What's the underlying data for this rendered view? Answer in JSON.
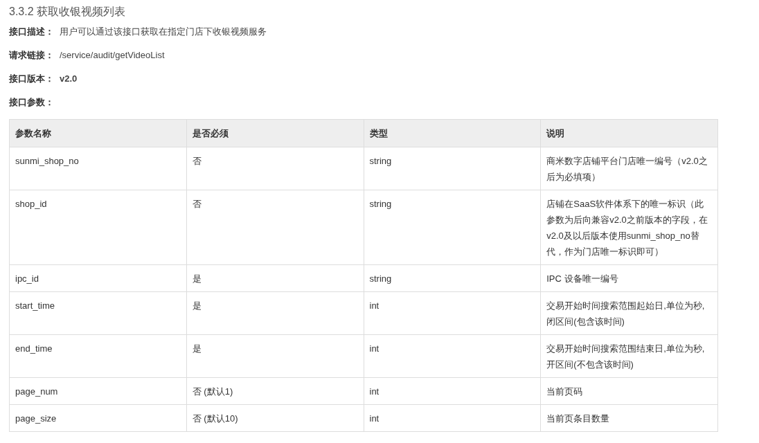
{
  "heading": "3.3.2 获取收银视频列表",
  "fields": [
    {
      "label": "接口描述：",
      "value": "用户可以通过该接口获取在指定门店下收银视频服务",
      "kind": "plain"
    },
    {
      "label": "请求链接：",
      "value": "/service/audit/getVideoList",
      "kind": "plain"
    },
    {
      "label": "接口版本：",
      "value": "v2.0",
      "kind": "strong"
    },
    {
      "label": "接口参数：",
      "kind": "label_only"
    }
  ],
  "table": {
    "columns": [
      "参数名称",
      "是否必须",
      "类型",
      "说明"
    ],
    "rows": [
      [
        "sunmi_shop_no",
        "否",
        "string",
        "商米数字店铺平台门店唯一编号（v2.0之后为必填项）"
      ],
      [
        "shop_id",
        "否",
        "string",
        "店铺在SaaS软件体系下的唯一标识（此参数为后向兼容v2.0之前版本的字段，在v2.0及以后版本使用sunmi_shop_no替代，作为门店唯一标识即可）"
      ],
      [
        "ipc_id",
        "是",
        "string",
        "IPC 设备唯一编号"
      ],
      [
        "start_time",
        "是",
        "int",
        "交易开始时间搜索范围起始日,单位为秒,闭区间(包含该时间)"
      ],
      [
        "end_time",
        "是",
        "int",
        "交易开始时间搜索范围结束日,单位为秒,开区间(不包含该时间)"
      ],
      [
        "page_num",
        "否 (默认1)",
        "int",
        "当前页码"
      ],
      [
        "page_size",
        "否 (默认10)",
        "int",
        "当前页条目数量"
      ]
    ]
  }
}
